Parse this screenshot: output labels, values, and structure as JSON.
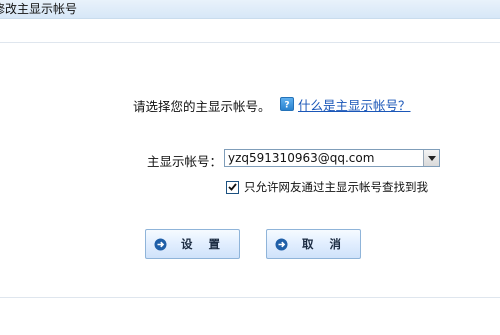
{
  "window": {
    "title": "修改主显示帐号"
  },
  "prompt": {
    "text": "请选择您的主显示帐号。"
  },
  "help": {
    "link_text": "什么是主显示帐号？"
  },
  "account": {
    "label": "主显示帐号：",
    "selected_value": "yzq591310963@qq.com"
  },
  "option": {
    "label": "只允许网友通过主显示帐号查找到我",
    "checked": true
  },
  "buttons": {
    "ok_label": "设 置",
    "cancel_label": "取 消"
  },
  "colors": {
    "link": "#1b57b8",
    "titlebar": "#d7e7f7",
    "button_face": "#cfe2fa",
    "button_icon": "#1f5fa8"
  }
}
